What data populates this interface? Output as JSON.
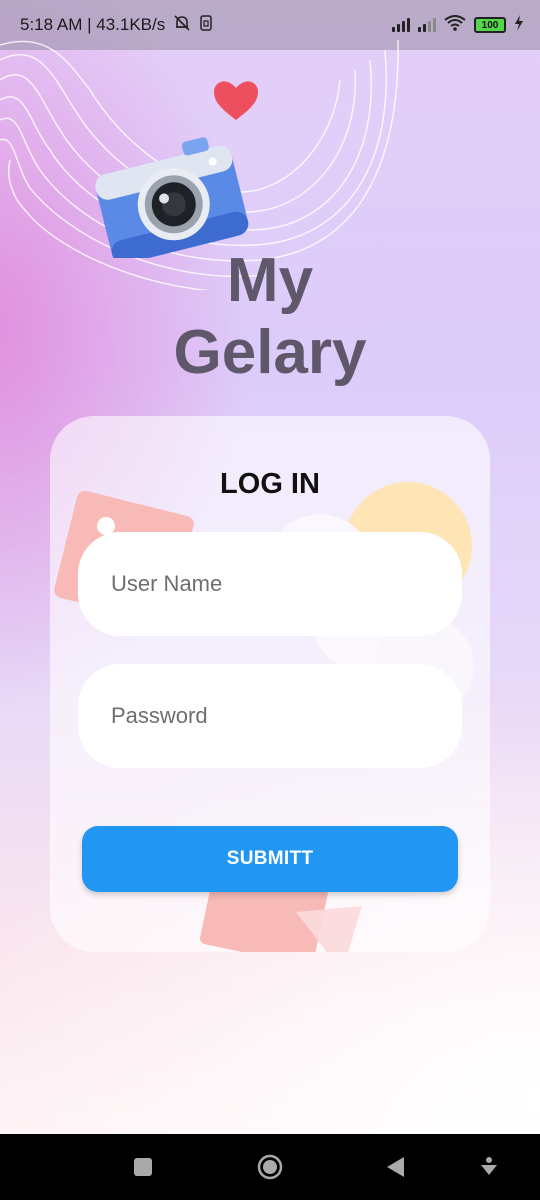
{
  "status_bar": {
    "time_speed": "5:18 AM | 43.1KB/s",
    "battery": "100",
    "icons": [
      "mute-bell-icon",
      "sim-icon",
      "signal-icon",
      "wifi-icon",
      "battery-icon",
      "charging-icon"
    ]
  },
  "header": {
    "title_line1": "My",
    "title_line2": "Gelary"
  },
  "login": {
    "title": "LOG IN",
    "username_placeholder": "User Name",
    "username_value": "",
    "password_placeholder": "Password",
    "password_value": "",
    "submit_label": "SUBMITT"
  },
  "nav_bar": {
    "icons": [
      "recent-apps-icon",
      "home-icon",
      "back-icon",
      "assist-icon"
    ]
  },
  "colors": {
    "accent": "#2196f3",
    "title": "#5f586b",
    "card": "#ffffff"
  }
}
